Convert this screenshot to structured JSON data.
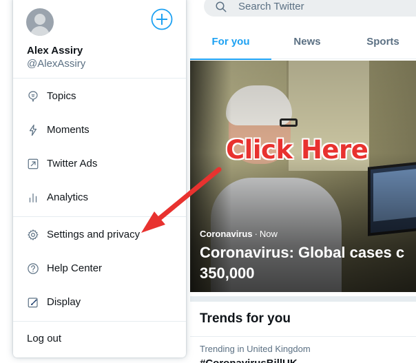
{
  "search": {
    "placeholder": "Search Twitter"
  },
  "tabs": [
    {
      "label": "For you",
      "active": true
    },
    {
      "label": "News",
      "active": false
    },
    {
      "label": "Sports",
      "active": false
    }
  ],
  "hero": {
    "category": "Coronavirus",
    "separator": "·",
    "time": "Now",
    "headline_line1": "Coronavirus: Global cases c",
    "headline_line2": "350,000"
  },
  "annotation": {
    "text": "Click Here",
    "color": "#e8322f"
  },
  "trends": {
    "title": "Trends for you",
    "items": [
      {
        "context": "Trending in United Kingdom",
        "tag": "#CoronavirusBillUK"
      }
    ]
  },
  "account": {
    "name": "Alex Assiry",
    "handle": "@AlexAssiry"
  },
  "menu": {
    "items": [
      {
        "label": "Topics",
        "icon": "topics-icon"
      },
      {
        "label": "Moments",
        "icon": "moments-icon"
      },
      {
        "label": "Twitter Ads",
        "icon": "twitter-ads-icon"
      },
      {
        "label": "Analytics",
        "icon": "analytics-icon"
      },
      {
        "label": "Settings and privacy",
        "icon": "gear-icon"
      },
      {
        "label": "Help Center",
        "icon": "help-icon"
      },
      {
        "label": "Display",
        "icon": "display-icon"
      }
    ],
    "logout": "Log out"
  },
  "colors": {
    "accent": "#1da1f2",
    "text": "#0f1419",
    "secondary": "#5b7083"
  }
}
